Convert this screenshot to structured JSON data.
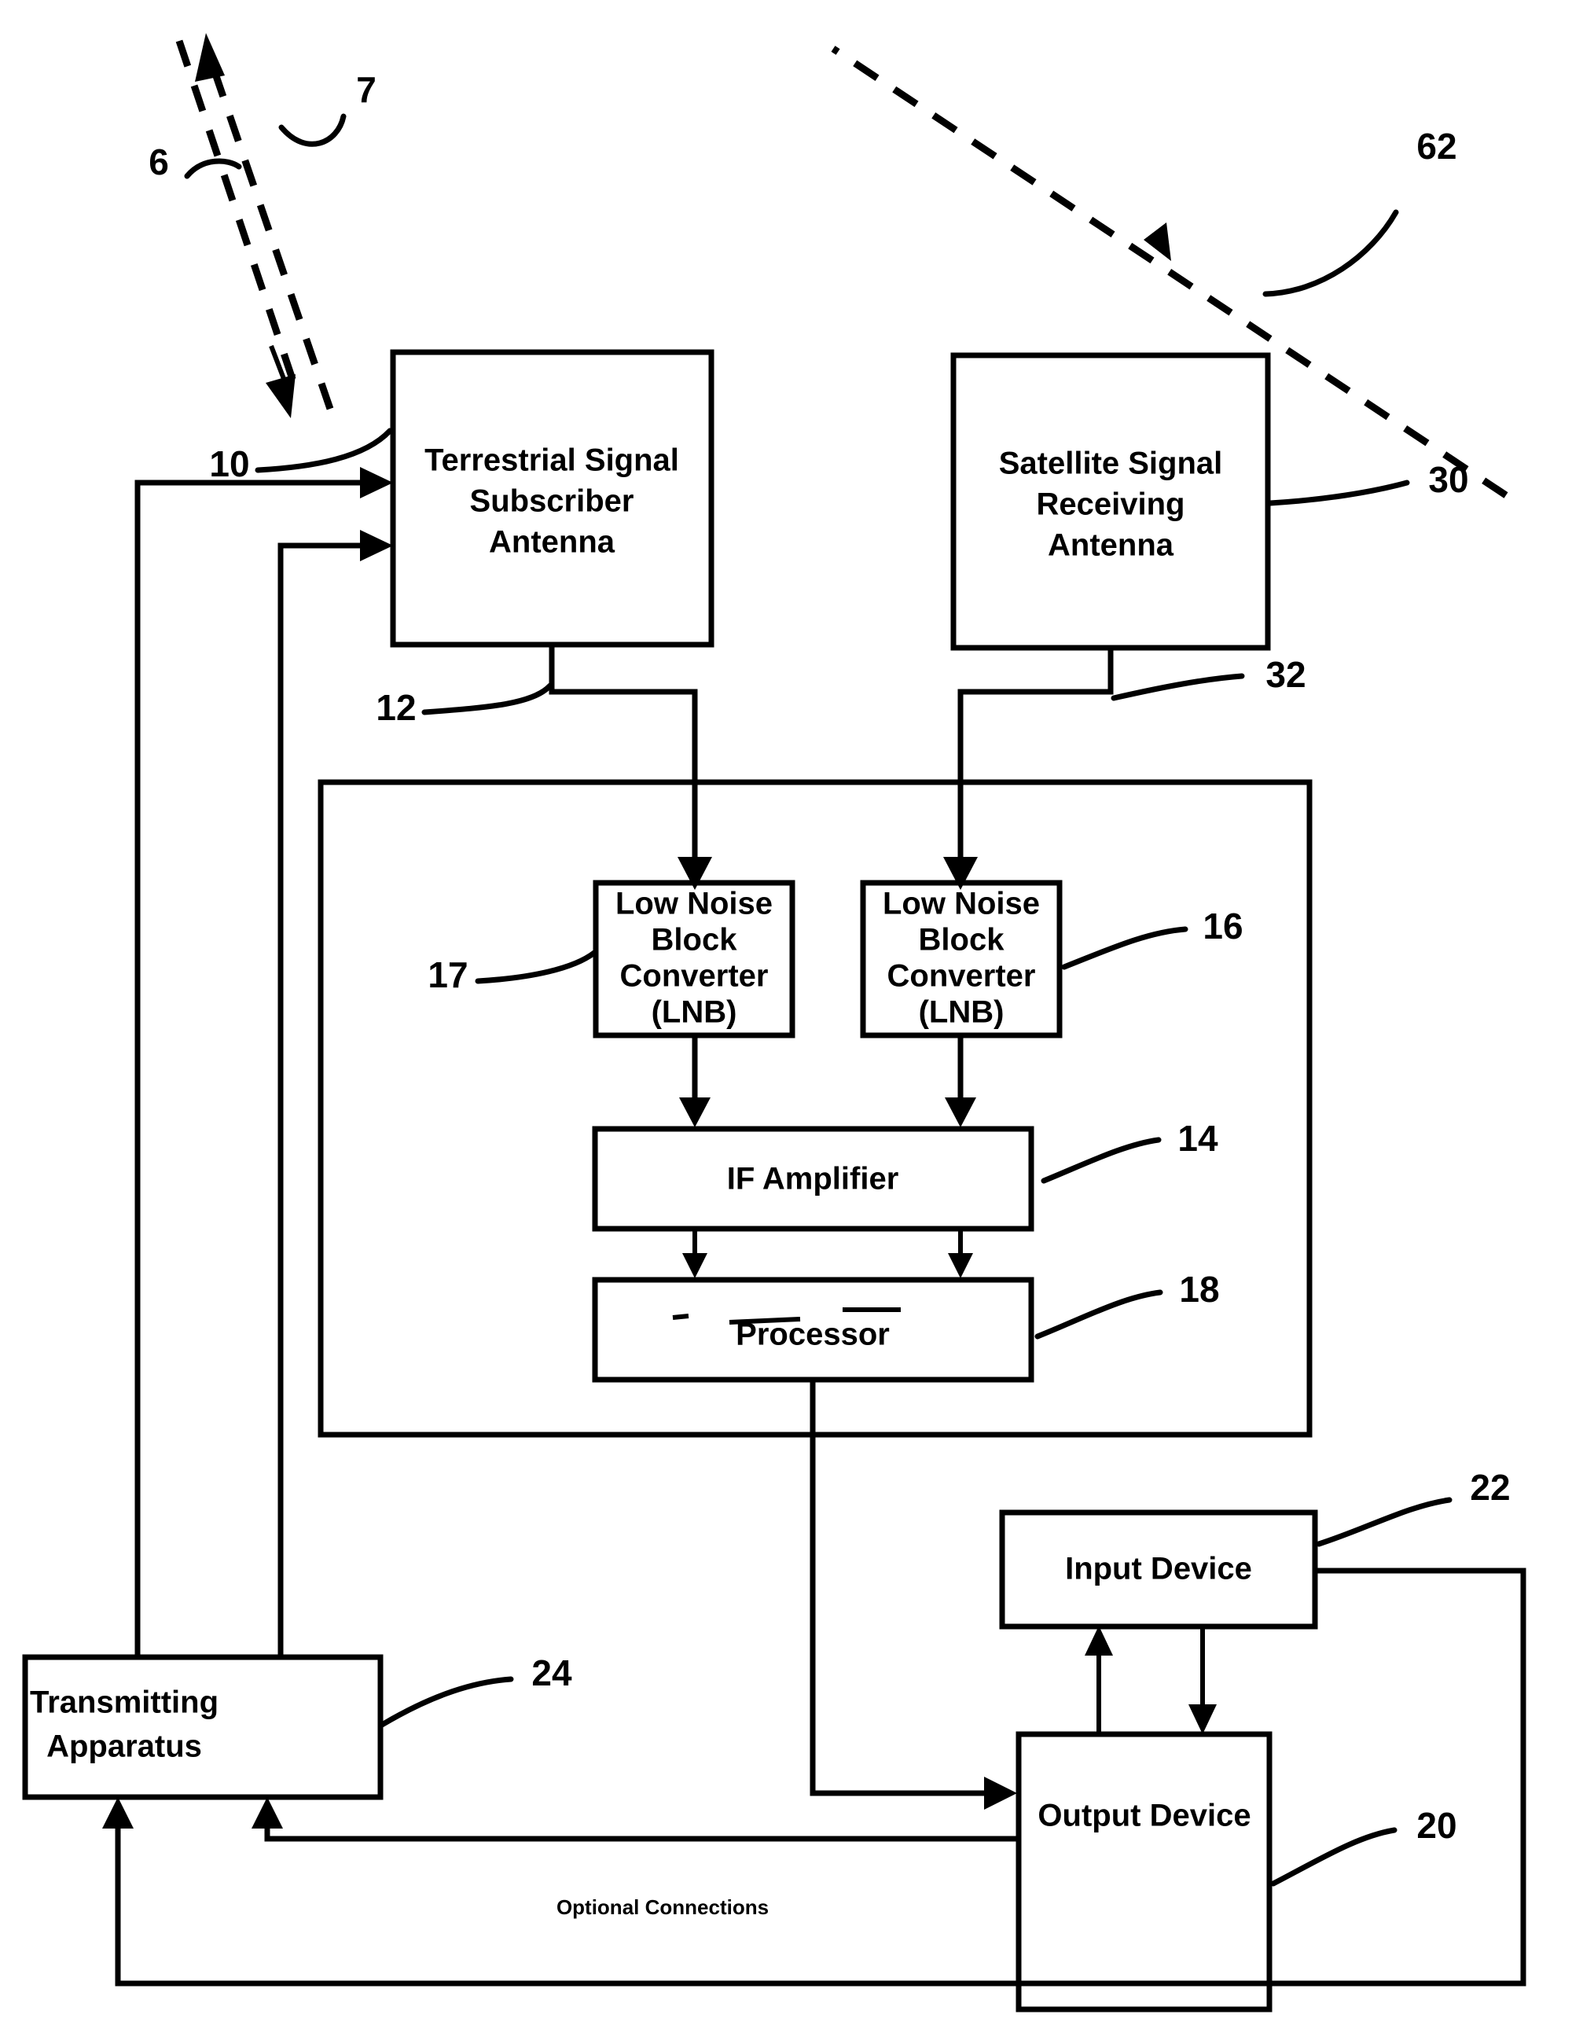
{
  "figure": {
    "kind": "patent-block-diagram",
    "note_label": "Optional Connections",
    "ink_color": "#000000",
    "background_color": "#ffffff"
  },
  "blocks": {
    "terrestrial_antenna": {
      "line1": "Terrestrial Signal",
      "line2": "Subscriber",
      "line3": "Antenna",
      "ref": "10"
    },
    "satellite_antenna": {
      "line1": "Satellite Signal",
      "line2": "Receiving",
      "line3": "Antenna",
      "ref": "30"
    },
    "lnb_left": {
      "line1": "Low Noise",
      "line2": "Block",
      "line3": "Converter",
      "line4": "(LNB)",
      "ref": "17"
    },
    "lnb_right": {
      "line1": "Low Noise",
      "line2": "Block",
      "line3": "Converter",
      "line4": "(LNB)",
      "ref": "16"
    },
    "if_amplifier": {
      "label": "IF Amplifier",
      "ref": "14"
    },
    "processor": {
      "label": "Processor",
      "ref": "18"
    },
    "transmitting_apparatus": {
      "line1": "Transmitting",
      "line2": "Apparatus",
      "ref": "24"
    },
    "input_device": {
      "label": "Input Device",
      "ref": "22"
    },
    "output_device": {
      "label": "Output Device",
      "ref": "20"
    }
  },
  "signals": {
    "uplink_beam_ref": "7",
    "downlink_beam_ref": "6",
    "satellite_beam_ref": "62",
    "terrestrial_feed_ref": "12",
    "satellite_feed_ref": "32"
  }
}
